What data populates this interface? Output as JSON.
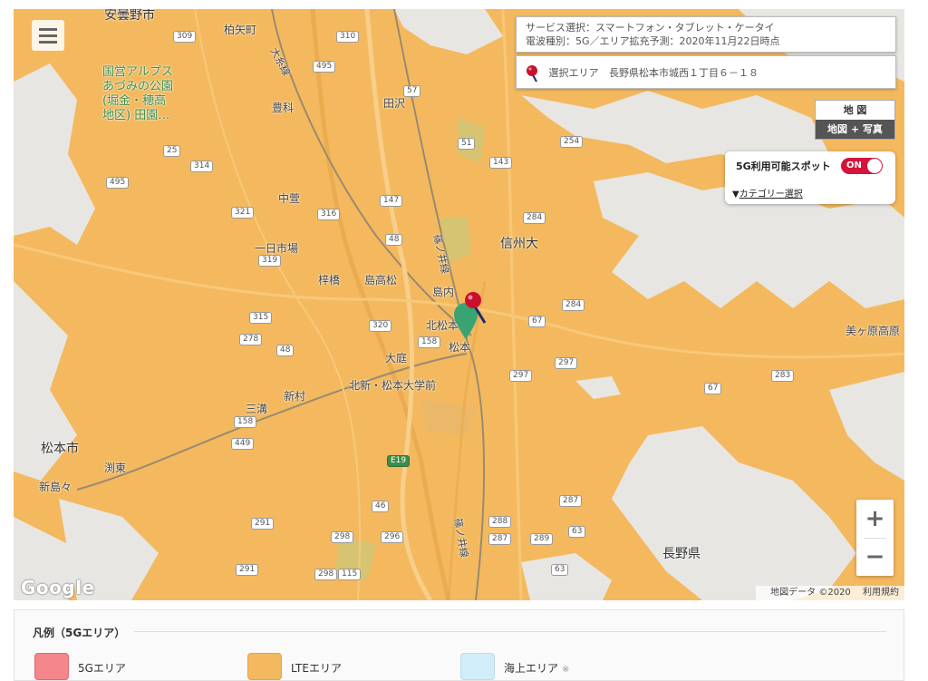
{
  "map": {
    "places": [
      {
        "key": "azumino",
        "label": "安曇野市"
      },
      {
        "key": "kashiwayacho",
        "label": "柏矢町"
      },
      {
        "key": "park",
        "label": "国営アルプス\nあづみの公園\n(堀金・穂高\n地区) 田園…"
      },
      {
        "key": "toyoshina",
        "label": "豊科"
      },
      {
        "key": "tazawa",
        "label": "田沢"
      },
      {
        "key": "nakagaya",
        "label": "中萱"
      },
      {
        "key": "ichinichiichiba",
        "label": "一日市場"
      },
      {
        "key": "shinshudai",
        "label": "信州大"
      },
      {
        "key": "umegawa",
        "label": "梓橋"
      },
      {
        "key": "shimashima",
        "label": "島高松"
      },
      {
        "key": "shimanouchi",
        "label": "島内"
      },
      {
        "key": "kitamatsumoto",
        "label": "北松本"
      },
      {
        "key": "matsumoto",
        "label": "松本"
      },
      {
        "key": "oniwa",
        "label": "大庭"
      },
      {
        "key": "niimura",
        "label": "新村"
      },
      {
        "key": "kitashin",
        "label": "北新・松本大学前"
      },
      {
        "key": "sanko",
        "label": "三溝"
      },
      {
        "key": "matsumotoshi",
        "label": "松本市"
      },
      {
        "key": "seba",
        "label": "渕東"
      },
      {
        "key": "niishimashima",
        "label": "新島々"
      },
      {
        "key": "utsukushigahara",
        "label": "美ヶ原高原"
      },
      {
        "key": "naganoken",
        "label": "長野県"
      }
    ],
    "routes": [
      "309",
      "310",
      "495",
      "57",
      "51",
      "25",
      "314",
      "321",
      "316",
      "147",
      "48",
      "143",
      "254",
      "284",
      "319",
      "315",
      "320",
      "158",
      "278",
      "48",
      "67",
      "284",
      "297",
      "297",
      "283",
      "67",
      "158",
      "449",
      "291",
      "298",
      "296",
      "46",
      "288",
      "287",
      "289",
      "63",
      "291",
      "298",
      "115",
      "63",
      "287",
      "495"
    ],
    "line_labels": [
      "大糸線",
      "篠ノ井線",
      "篠ノ井線"
    ],
    "expressway_label": "E19"
  },
  "info": {
    "service_line": "サービス選択：スマートフォン・タブレット・ケータイ",
    "radio_line": "電波種別：5G／エリア拡充予測：2020年11月22日時点",
    "area_label": "選択エリア",
    "area_value": "長野県松本市城西１丁目６－１８"
  },
  "maptype": {
    "map": "地 図",
    "satellite": "地図 + 写真"
  },
  "spots": {
    "title": "5G利用可能スポット",
    "toggle": "ON",
    "category_prefix": "▼",
    "category_link": "カテゴリー選択"
  },
  "zoom": {
    "in": "+",
    "out": "−"
  },
  "google": "Google",
  "attribution": {
    "data": "地図データ ©2020",
    "terms": "利用規約"
  },
  "legend": {
    "title": "凡例（5Gエリア）",
    "items": [
      {
        "label": "5Gエリア",
        "color": "#f4868c",
        "note": ""
      },
      {
        "label": "LTEエリア",
        "color": "#f4b95e",
        "note": ""
      },
      {
        "label": "海上エリア",
        "color": "#d2edfa",
        "note": "※"
      }
    ]
  },
  "colors": {
    "lte": "#f4b95e",
    "mountain": "#e6e6e4",
    "pin_red": "#c8102e",
    "pin_green": "#3aa372"
  }
}
